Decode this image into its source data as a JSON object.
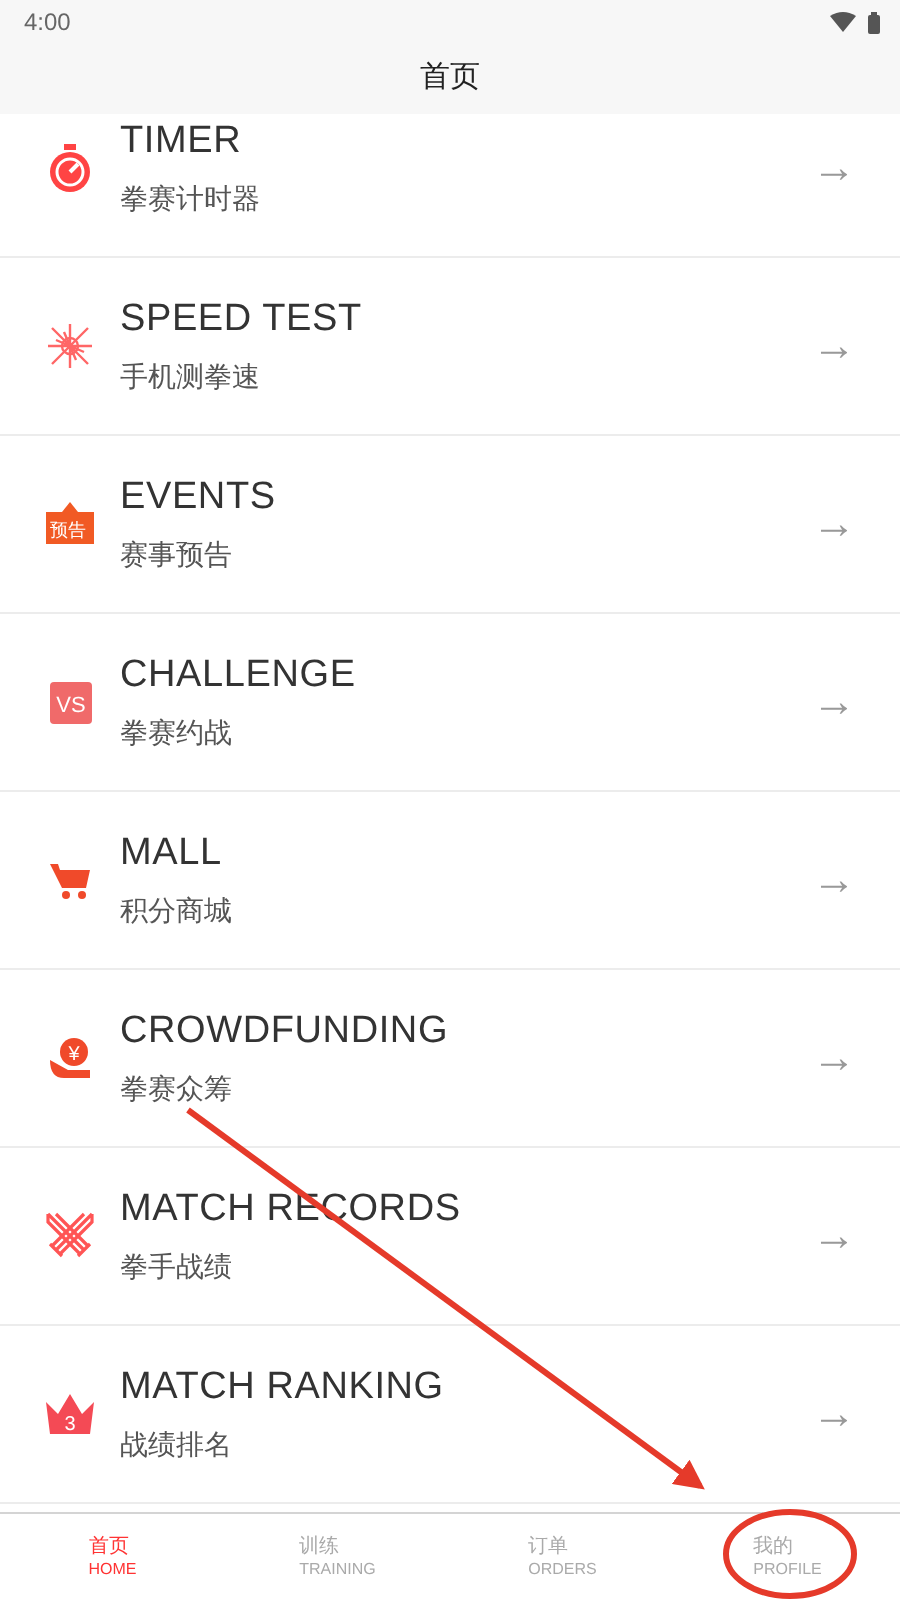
{
  "status_bar": {
    "time": "4:00"
  },
  "header": {
    "title": "首页"
  },
  "menu": [
    {
      "kind": "timer",
      "title": "TIMER",
      "subtitle": "拳赛计时器",
      "arrow": "→"
    },
    {
      "kind": "speed",
      "title": "SPEED TEST",
      "subtitle": "手机测拳速",
      "arrow": "→"
    },
    {
      "kind": "events",
      "title": "EVENTS",
      "subtitle": "赛事预告",
      "arrow": "→",
      "icon_text": "预告"
    },
    {
      "kind": "challenge",
      "title": "CHALLENGE",
      "subtitle": "拳赛约战",
      "arrow": "→",
      "icon_text": "VS"
    },
    {
      "kind": "mall",
      "title": "MALL",
      "subtitle": "积分商城",
      "arrow": "→"
    },
    {
      "kind": "crowdfunding",
      "title": "CROWDFUNDING",
      "subtitle": "拳赛众筹",
      "arrow": "→",
      "icon_text": "¥"
    },
    {
      "kind": "records",
      "title": "MATCH RECORDS",
      "subtitle": "拳手战绩",
      "arrow": "→"
    },
    {
      "kind": "ranking",
      "title": "MATCH RANKING",
      "subtitle": "战绩排名",
      "arrow": "→",
      "icon_text": "3"
    }
  ],
  "bottom_nav": [
    {
      "label": "首页",
      "sublabel": "HOME",
      "selected": true
    },
    {
      "label": "训练",
      "sublabel": "TRAINING",
      "selected": false
    },
    {
      "label": "订单",
      "sublabel": "ORDERS",
      "selected": false
    },
    {
      "label": "我的",
      "sublabel": "PROFILE",
      "selected": false
    }
  ]
}
